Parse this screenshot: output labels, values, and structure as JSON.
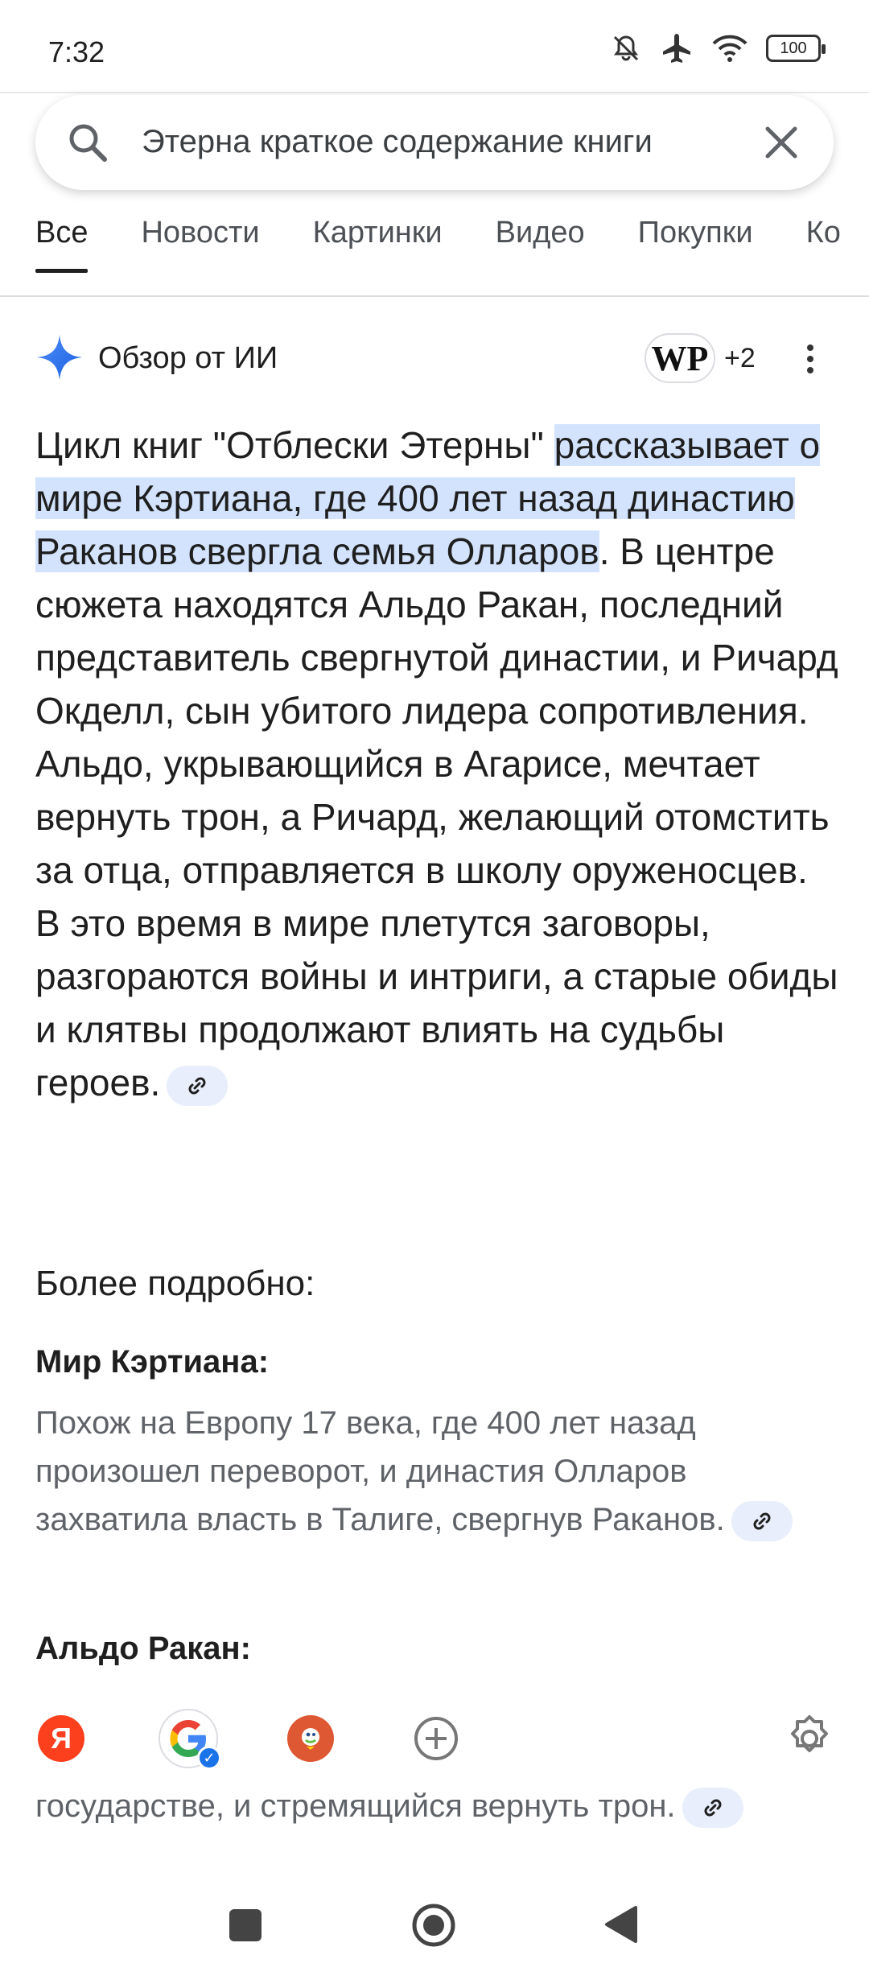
{
  "status_bar": {
    "time": "7:32",
    "battery": "100",
    "icons": [
      "mute-icon",
      "airplane-icon",
      "wifi-icon",
      "battery-icon"
    ]
  },
  "search": {
    "query": "Этерна краткое содержание книги"
  },
  "tabs": [
    {
      "label": "Все",
      "active": true
    },
    {
      "label": "Новости",
      "active": false
    },
    {
      "label": "Картинки",
      "active": false
    },
    {
      "label": "Видео",
      "active": false
    },
    {
      "label": "Покупки",
      "active": false
    },
    {
      "label": "Ко",
      "active": false
    }
  ],
  "ai_overview": {
    "title": "Обзор от ИИ",
    "source_logo": "WP",
    "source_more": "+2",
    "paragraph": {
      "p1": "Цикл книг \"Отблески Этерны\" ",
      "highlight": "рассказывает о мире Кэртиана, где 400 лет назад династию Раканов свергла семья Олларов",
      "p2": ". В центре сюжета находятся Альдо Ракан, последний представитель свергнутой династии, и Ричард Окделл, сын убитого лидера сопротивления. Альдо, укрывающийся в Агарисе, мечтает вернуть трон, а Ричард, желающий отомстить за отца, отправляется в школу оруженосцев. В это время в мире плетутся заговоры, разгораются войны и интриги, а старые обиды и клятвы продолжают влиять на судьбы героев."
    },
    "more_title": "Более подробно:",
    "sections": [
      {
        "heading": "Мир Кэртиана:",
        "text": "Похож на Европу 17 века, где 400 лет назад произошел переворот, и династия Олларов захватила власть в Талиге, свергнув Раканов."
      },
      {
        "heading": "Альдо Ракан:",
        "text": "государстве, и стремящийся вернуть трон."
      }
    ]
  },
  "browser_bar": {
    "yandex_label": "Я"
  }
}
